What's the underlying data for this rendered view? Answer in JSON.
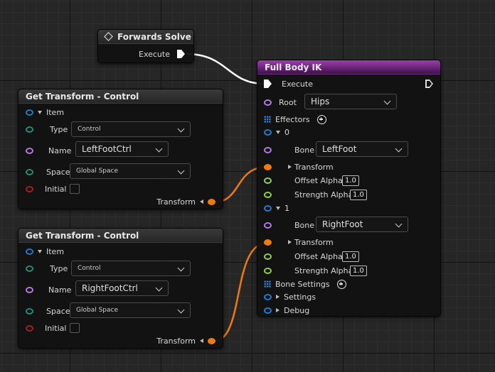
{
  "forwards_solve": {
    "title": "Forwards Solve",
    "execute_label": "Execute"
  },
  "get_transform_1": {
    "title": "Get Transform - Control",
    "item_label": "Item",
    "type_label": "Type",
    "type_value": "Control",
    "name_label": "Name",
    "name_value": "LeftFootCtrl",
    "space_label": "Space",
    "space_value": "Global Space",
    "initial_label": "Initial",
    "transform_label": "Transform"
  },
  "get_transform_2": {
    "title": "Get Transform - Control",
    "item_label": "Item",
    "type_label": "Type",
    "type_value": "Control",
    "name_label": "Name",
    "name_value": "RightFootCtrl",
    "space_label": "Space",
    "space_value": "Global Space",
    "initial_label": "Initial",
    "transform_label": "Transform"
  },
  "full_body_ik": {
    "title": "Full Body IK",
    "execute_label": "Execute",
    "root_label": "Root",
    "root_value": "Hips",
    "effectors_label": "Effectors",
    "effectors": [
      {
        "index": "0",
        "bone_label": "Bone",
        "bone_value": "LeftFoot",
        "transform_label": "Transform",
        "offset_alpha_label": "Offset Alpha",
        "offset_alpha_value": "1.0",
        "strength_alpha_label": "Strength Alpha",
        "strength_alpha_value": "1.0"
      },
      {
        "index": "1",
        "bone_label": "Bone",
        "bone_value": "RightFoot",
        "transform_label": "Transform",
        "offset_alpha_label": "Offset Alpha",
        "offset_alpha_value": "1.0",
        "strength_alpha_label": "Strength Alpha",
        "strength_alpha_value": "1.0"
      }
    ],
    "bone_settings_label": "Bone Settings",
    "settings_label": "Settings",
    "debug_label": "Debug"
  },
  "colors": {
    "exec_wire": "#ffffff",
    "transform_wire": "#f07a10",
    "header_purple": "#7a2e8c",
    "pin_struct_blue": "#1f7bd1",
    "pin_enum_teal": "#1d8f74",
    "pin_name_purple": "#b478e0",
    "pin_bool_red": "#b01a1a",
    "pin_float_green": "#8ed14a"
  }
}
